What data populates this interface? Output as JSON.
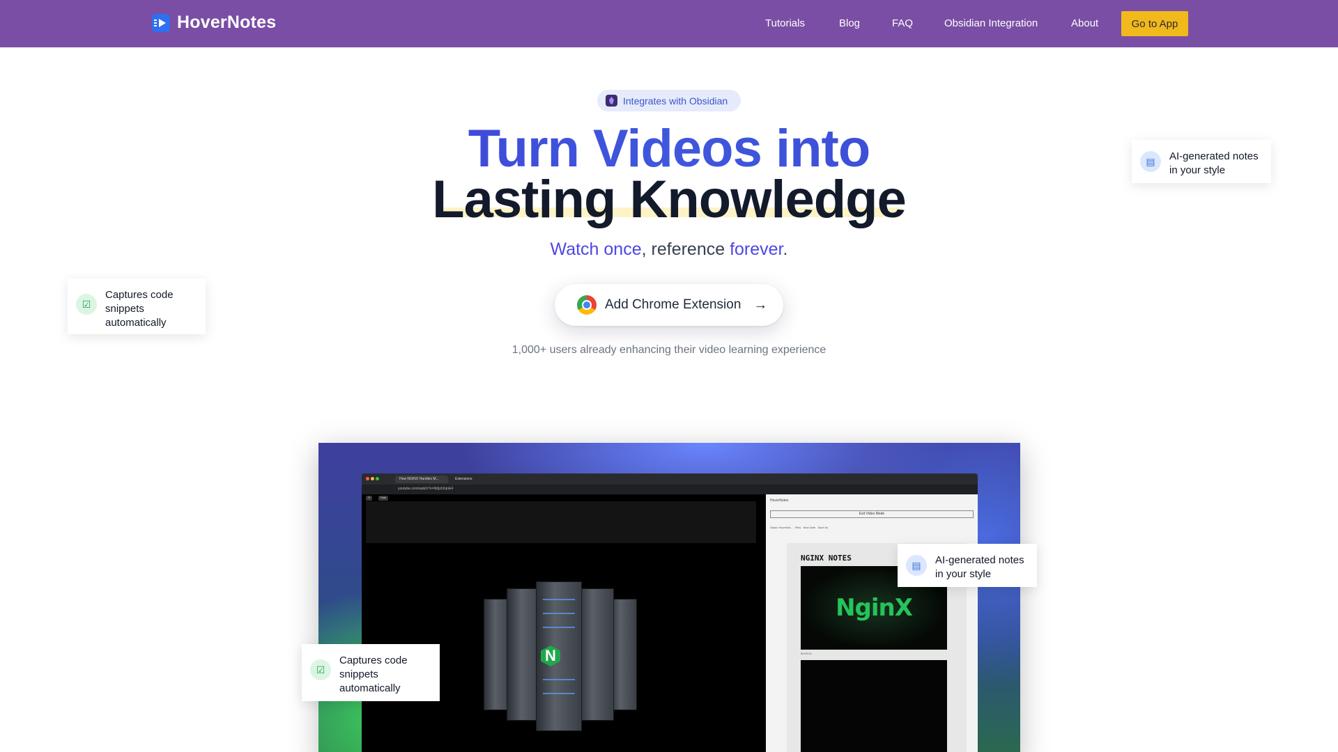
{
  "nav": {
    "brand": "HoverNotes",
    "links": [
      {
        "label": "Tutorials"
      },
      {
        "label": "Blog"
      },
      {
        "label": "FAQ"
      },
      {
        "label": "Obsidian Integration"
      },
      {
        "label": "About"
      }
    ],
    "cta": "Go to App"
  },
  "hero": {
    "badge": "Integrates with Obsidian",
    "headline_line1": "Turn Videos into",
    "headline_line2": "Lasting Knowledge",
    "tagline": {
      "part1": "Watch once",
      "part2": ", reference ",
      "part3": "forever",
      "part4": "."
    },
    "cta_label": "Add Chrome Extension",
    "users_text": "1,000+ users already enhancing their video learning experience"
  },
  "features": {
    "notes": "AI-generated notes in your style",
    "code": "Captures code snippets automatically"
  },
  "showcase": {
    "tab_1": "How NGINX Handles M...",
    "tab_2": "Extensions",
    "url": "youtube.com/watch?v=Ib0jzh2qnE4",
    "btn_x": "✕",
    "btn_hide": "Hide",
    "panel_title": "HoverNotes",
    "exit_video": "Exit Video Mode",
    "tool_1": "Stack: HoverNot...",
    "tool_2": "Files",
    "tool_3": "New Note",
    "tool_4": "Save As",
    "notes_title": "NGINX NOTES",
    "video_title": "NginX",
    "timestamp": "00:00:24"
  },
  "colors": {
    "nav_bg": "#7a4ea4",
    "accent": "#4f46e5",
    "cta_yellow": "#f2b91c"
  },
  "icons": {
    "brand": "play-icon",
    "badge": "obsidian-icon",
    "cta": "chrome-icon",
    "cta_arrow": "arrow-right-icon",
    "notes": "document-icon",
    "code": "check-square-icon"
  }
}
